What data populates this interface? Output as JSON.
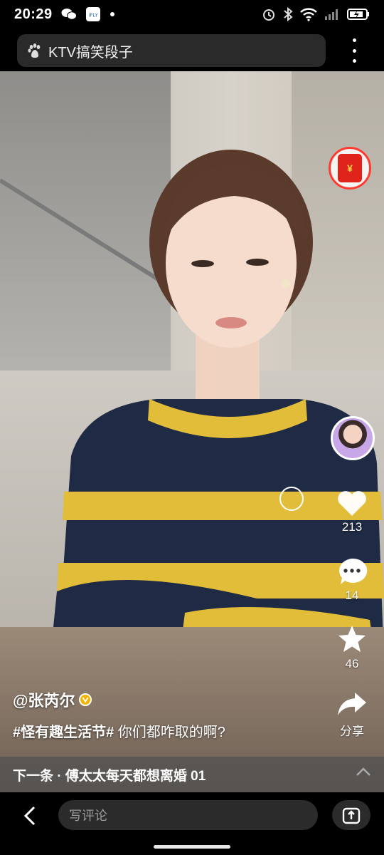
{
  "status_bar": {
    "time": "20:29",
    "left_icons": [
      "wechat-icon",
      "ifly-app-icon",
      "dot-icon"
    ],
    "right_icons": [
      "alarm-icon",
      "bluetooth-icon",
      "wifi-icon",
      "signal-icon",
      "battery-icon"
    ],
    "ifly_label": "iFLY"
  },
  "search": {
    "query": "KTV搞笑段子",
    "left_icon": "baidu-paw-icon"
  },
  "video": {
    "red_packet_icon": "red-packet-icon",
    "red_packet_glyph": "¥",
    "author_avatar_icon": "avatar",
    "likes": "213",
    "comments": "14",
    "favorites": "46",
    "share_label": "分享",
    "author": "@张芮尔",
    "caption_hashtag": "#怪有趣生活节#",
    "caption_text": " 你们都咋取的啊?"
  },
  "next": {
    "label": "下一条 · 傅太太每天都想离婚 01"
  },
  "bottom_bar": {
    "comment_placeholder": "写评论"
  },
  "colors": {
    "accent_red": "#ff3b30",
    "verified_badge": "#f4b400"
  }
}
